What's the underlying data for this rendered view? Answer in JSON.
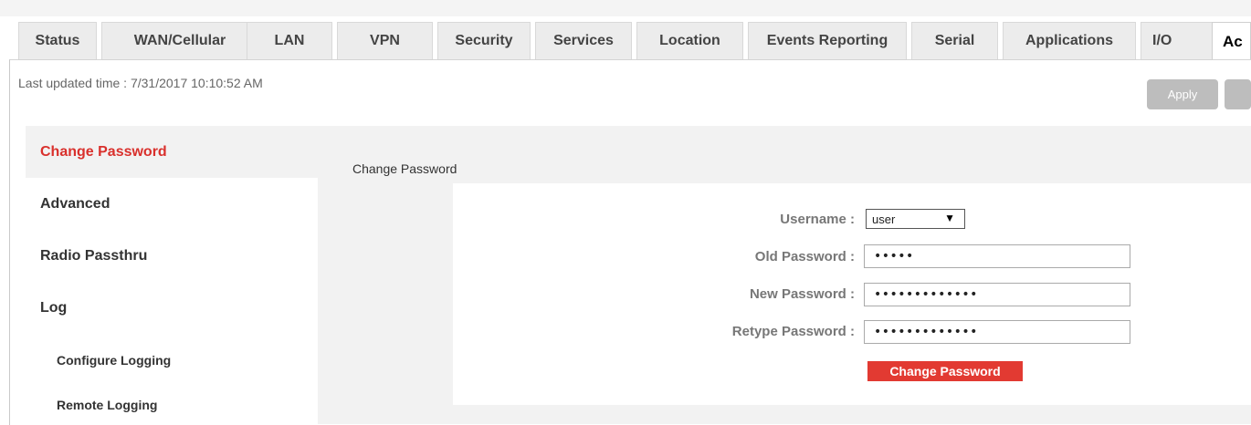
{
  "tabs": [
    {
      "label": "Status"
    },
    {
      "label": "WAN/Cellular"
    },
    {
      "label": "LAN"
    },
    {
      "label": "VPN"
    },
    {
      "label": "Security"
    },
    {
      "label": "Services"
    },
    {
      "label": "Location"
    },
    {
      "label": "Events Reporting"
    },
    {
      "label": "Serial"
    },
    {
      "label": "Applications"
    },
    {
      "label": "I/O"
    },
    {
      "label": "Ac"
    }
  ],
  "header": {
    "last_updated": "Last updated time : 7/31/2017 10:10:52 AM",
    "apply_label": "Apply"
  },
  "menu": {
    "items": [
      {
        "label": "Change Password"
      },
      {
        "label": "Advanced"
      },
      {
        "label": "Radio Passthru"
      },
      {
        "label": "Log"
      },
      {
        "label": "Configure Logging"
      },
      {
        "label": "Remote Logging"
      }
    ]
  },
  "form": {
    "section_title": "Change Password",
    "username_label": "Username :",
    "username_value": "user",
    "old_password_label": "Old Password :",
    "old_password_value": "•••••",
    "new_password_label": "New Password :",
    "new_password_value": "•••••••••••••",
    "retype_password_label": "Retype Password :",
    "retype_password_value": "•••••••••••••",
    "submit_label": "Change Password"
  },
  "colors": {
    "accent": "#e23a32",
    "active_menu_text": "#d9302c"
  }
}
